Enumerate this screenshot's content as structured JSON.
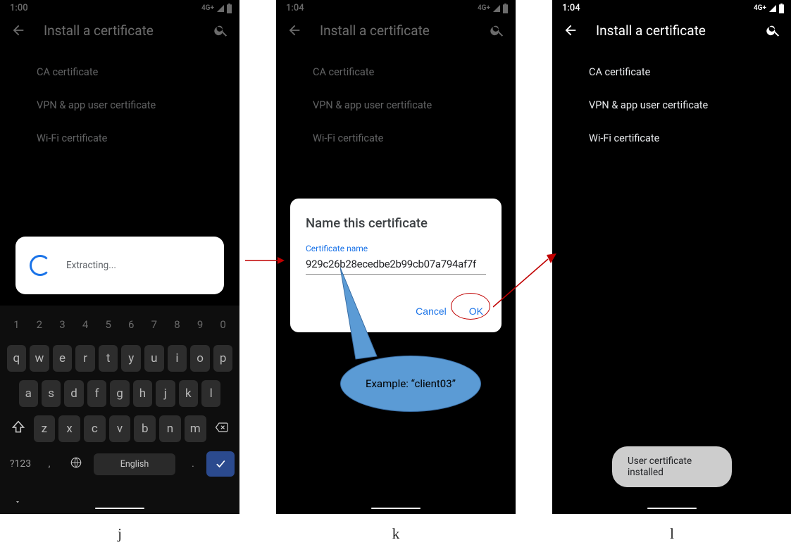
{
  "status": {
    "network": "4G+"
  },
  "captions": {
    "j": "j",
    "k": "k",
    "l": "l"
  },
  "phone_j": {
    "time": "1:00",
    "title": "Install a certificate",
    "menu": [
      "CA certificate",
      "VPN & app user certificate",
      "Wi-Fi certificate"
    ],
    "extracting": "Extracting...",
    "kb_lang": "English",
    "kb_sym": "?123"
  },
  "phone_k": {
    "time": "1:04",
    "title": "Install a certificate",
    "menu": [
      "CA certificate",
      "VPN & app user certificate",
      "Wi-Fi certificate"
    ],
    "dialog": {
      "title": "Name this certificate",
      "label": "Certificate name",
      "value": "929c26b28ecedbe2b99cb07a794af7f",
      "cancel": "Cancel",
      "ok": "OK"
    }
  },
  "phone_l": {
    "time": "1:04",
    "title": "Install a certificate",
    "menu": [
      "CA certificate",
      "VPN & app user certificate",
      "Wi-Fi certificate"
    ],
    "toast": "User certificate installed"
  },
  "callout": "Example: “client03”"
}
